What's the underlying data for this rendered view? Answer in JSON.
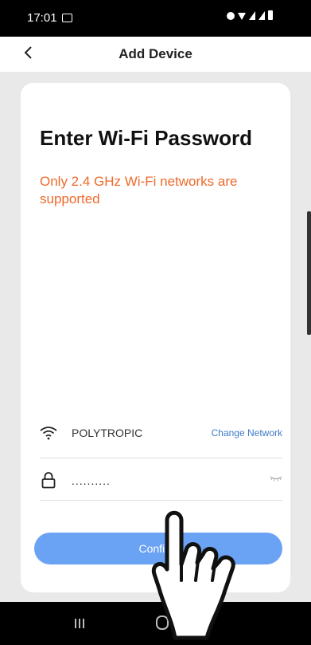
{
  "status_bar": {
    "time": "17:01"
  },
  "header": {
    "title": "Add Device"
  },
  "card": {
    "title": "Enter Wi-Fi Password",
    "notice": "Only 2.4 GHz Wi-Fi networks are supported",
    "network_name": "POLYTROPIC",
    "change_network_label": "Change Network",
    "password_value": "..........",
    "confirm_label": "Confirm"
  },
  "colors": {
    "accent": "#6aa2f4",
    "notice": "#ee6a2c",
    "link": "#3f78c8"
  },
  "icons": [
    "back-icon",
    "wifi-icon",
    "lock-icon",
    "eye-toggle-icon",
    "pointing-hand-icon"
  ]
}
